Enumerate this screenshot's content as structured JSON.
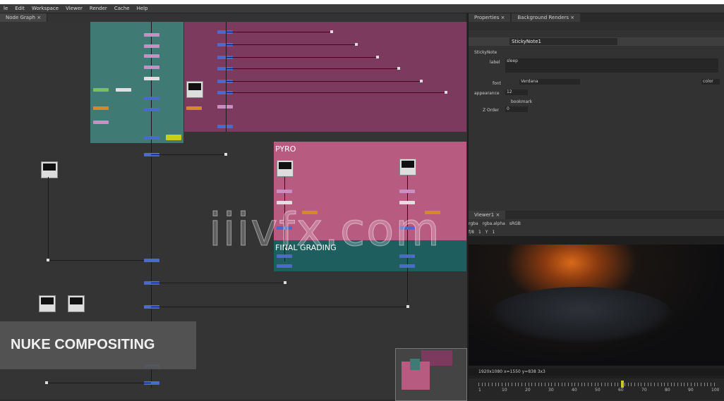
{
  "menu": [
    "le",
    "Edit",
    "Workspace",
    "Viewer",
    "Render",
    "Cache",
    "Help"
  ],
  "node_graph": {
    "tab_label": "Node Graph",
    "backdrops": {
      "pyro": "PYRO",
      "final_grading": "FINAL GRADING"
    }
  },
  "properties": {
    "tabs": [
      "Properties",
      "Background Renders"
    ],
    "node_name": "StickyNote1",
    "rows": {
      "sticky_note": "StickyNote",
      "label_key": "label",
      "label_val": "sleep",
      "font_key": "font",
      "font_val": "Verdana",
      "appearance_key": "appearance",
      "appearance_val": "12",
      "bookmark": "bookmark",
      "zorder_key": "Z Order",
      "zorder_val": "0",
      "color_btn": "color"
    }
  },
  "viewer": {
    "tab_label": "Viewer1",
    "toolbar": [
      "rgba",
      "rgba.alpha",
      "sRGB",
      "f/8",
      "1",
      "Y",
      "1"
    ],
    "status": "1920x1080  x=1550 y=838 3x3",
    "frame_numbers": [
      "1",
      "10",
      "20",
      "30",
      "40",
      "50",
      "60",
      "70",
      "80",
      "90",
      "100"
    ]
  },
  "banner": {
    "title": "NUKE COMPOSITING"
  },
  "watermark": "iiivfx.com",
  "colors": {
    "teal_backdrop": "#3f7a74",
    "magenta_backdrop": "#7c3a5e",
    "pyro_backdrop": "#b85b80",
    "grading_backdrop": "#1f5e5f"
  }
}
